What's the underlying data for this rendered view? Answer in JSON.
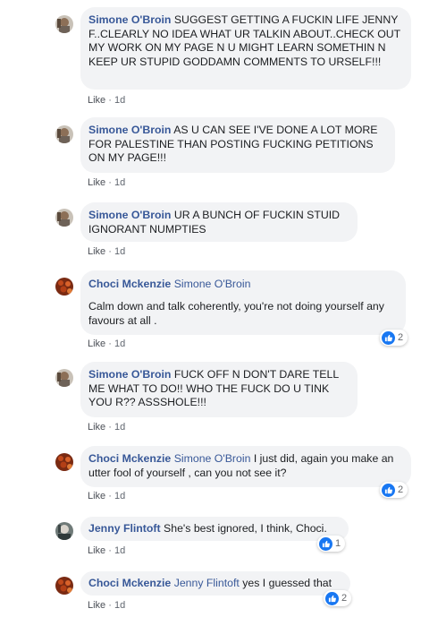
{
  "actions": {
    "like": "Like",
    "separator": "·"
  },
  "comments": [
    {
      "author": "Simone O'Broin",
      "mention": "",
      "text": "SUGGEST GETTING A FUCKIN LIFE JENNY F..CLEARLY NO IDEA WHAT UR TALKIN ABOUT..CHECK OUT MY WORK ON MY PAGE N U MIGHT LEARN SOMETHIN N KEEP UR STUPID GODDAMN COMMENTS TO URSELF!!!",
      "time": "1d",
      "reactions": ""
    },
    {
      "author": "Simone O'Broin",
      "mention": "",
      "text": "AS U CAN SEE I'VE DONE A LOT MORE FOR PALESTINE THAN POSTING FUCKING PETITIONS ON MY PAGE!!!",
      "time": "1d",
      "reactions": ""
    },
    {
      "author": "Simone O'Broin",
      "mention": "",
      "text": "UR A BUNCH OF FUCKIN STUID IGNORANT NUMPTIES",
      "time": "1d",
      "reactions": ""
    },
    {
      "author": "Choci Mckenzie",
      "mention": "Simone O'Broin",
      "text": "Calm down and talk coherently, you're not doing yourself any favours at all .",
      "time": "1d",
      "reactions": "2"
    },
    {
      "author": "Simone O'Broin",
      "mention": "",
      "text": "FUCK OFF N DON'T DARE TELL ME WHAT TO DO!! WHO THE FUCK DO U TINK YOU R?? ASSSHOLE!!!",
      "time": "1d",
      "reactions": ""
    },
    {
      "author": "Choci Mckenzie",
      "mention": "Simone O'Broin",
      "text": "I just did, again you make an utter fool of yourself , can you not see it?",
      "time": "1d",
      "reactions": "2"
    },
    {
      "author": "Jenny Flintoft",
      "mention": "",
      "text": "She's best ignored, I think, Choci.",
      "time": "1d",
      "reactions": "1"
    },
    {
      "author": "Choci Mckenzie",
      "mention": "Jenny Flintoft",
      "text": "yes I guessed that",
      "time": "1d",
      "reactions": "2"
    }
  ]
}
